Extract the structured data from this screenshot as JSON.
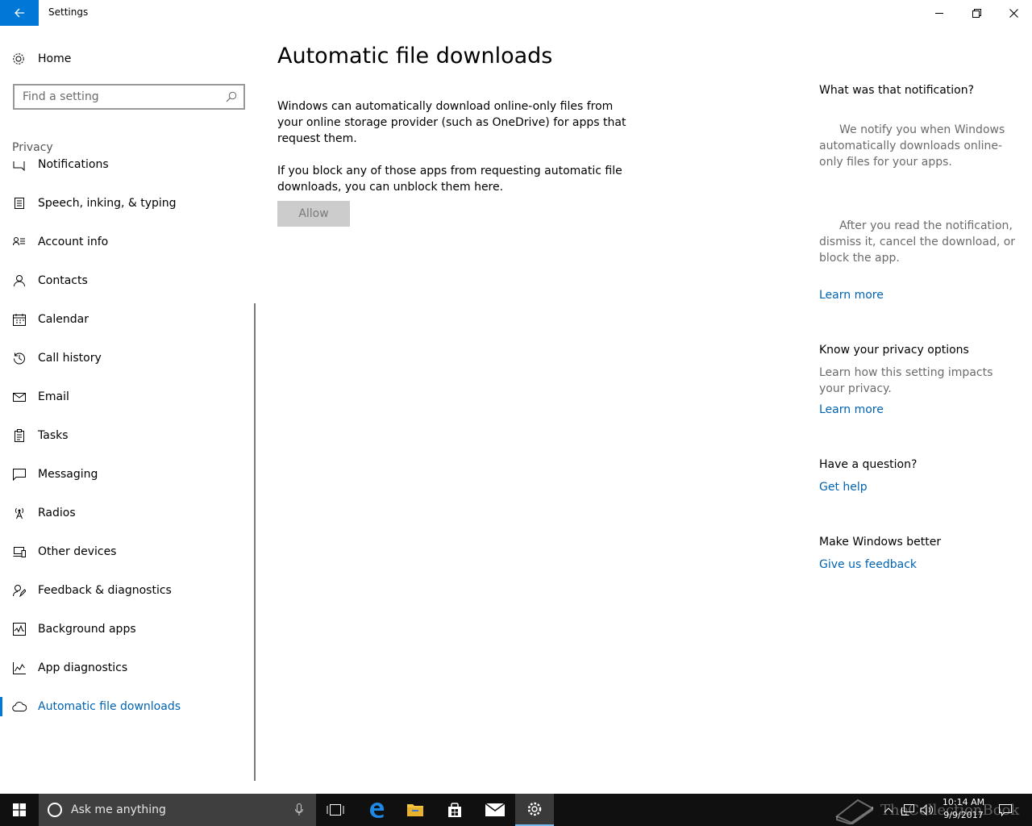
{
  "window": {
    "title": "Settings"
  },
  "sidebar": {
    "home_label": "Home",
    "search_placeholder": "Find a setting",
    "section_label": "Privacy",
    "items": [
      {
        "label": "Notifications",
        "icon": "notifications-icon"
      },
      {
        "label": "Speech, inking, & typing",
        "icon": "speech-icon"
      },
      {
        "label": "Account info",
        "icon": "account-info-icon"
      },
      {
        "label": "Contacts",
        "icon": "contacts-icon"
      },
      {
        "label": "Calendar",
        "icon": "calendar-icon"
      },
      {
        "label": "Call history",
        "icon": "history-icon"
      },
      {
        "label": "Email",
        "icon": "email-icon"
      },
      {
        "label": "Tasks",
        "icon": "tasks-icon"
      },
      {
        "label": "Messaging",
        "icon": "messaging-icon"
      },
      {
        "label": "Radios",
        "icon": "radio-icon"
      },
      {
        "label": "Other devices",
        "icon": "devices-icon"
      },
      {
        "label": "Feedback & diagnostics",
        "icon": "feedback-icon"
      },
      {
        "label": "Background apps",
        "icon": "background-apps-icon"
      },
      {
        "label": "App diagnostics",
        "icon": "app-diagnostics-icon"
      },
      {
        "label": "Automatic file downloads",
        "icon": "cloud-icon",
        "active": true
      }
    ]
  },
  "main": {
    "title": "Automatic file downloads",
    "paragraph1": "Windows can automatically download online-only files from your online storage provider (such as OneDrive) for apps that request them.",
    "paragraph2": "If you block any of those apps from requesting automatic file downloads, you can unblock them here.",
    "allow_label": "Allow"
  },
  "right_panel": {
    "notification_heading": "What was that notification?",
    "notification_text1": "We notify you when Windows automatically downloads online-only files for your apps.",
    "notification_text2": "After you read the notification, dismiss it, cancel the download, or block the app.",
    "learn_more_1": "Learn more",
    "privacy_heading": "Know your privacy options",
    "privacy_text": "Learn how this setting impacts your privacy.",
    "learn_more_2": "Learn more",
    "question_heading": "Have a question?",
    "get_help": "Get help",
    "better_heading": "Make Windows better",
    "feedback_link": "Give us feedback"
  },
  "taskbar": {
    "search_placeholder": "Ask me anything",
    "time": "10:14 AM",
    "date": "9/9/2017",
    "watermark": "TheCollectionBook"
  },
  "colors": {
    "accent": "#0078d7",
    "link": "#0063b1",
    "taskbar": "#101010"
  }
}
